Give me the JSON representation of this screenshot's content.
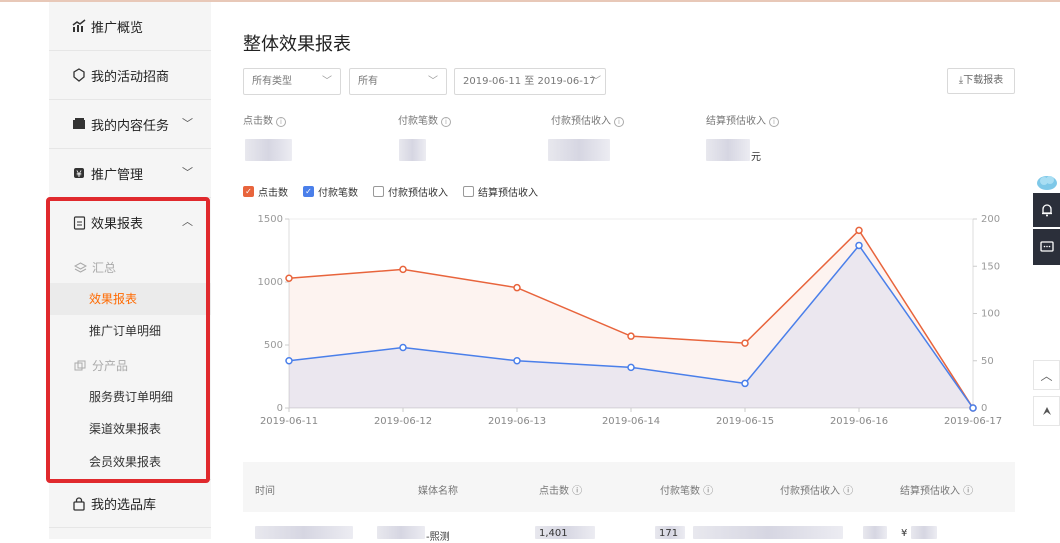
{
  "sidebar": {
    "items": [
      {
        "label": "推广概览",
        "icon": "chart-icon"
      },
      {
        "label": "我的活动招商",
        "icon": "shield-icon"
      },
      {
        "label": "我的内容任务",
        "icon": "book-icon"
      },
      {
        "label": "推广管理",
        "icon": "coin-icon"
      },
      {
        "label": "效果报表",
        "icon": "document-icon"
      },
      {
        "label": "我的选品库",
        "icon": "bag-icon"
      }
    ],
    "group_summary": "汇总",
    "group_product": "分产品",
    "sub_items": [
      "效果报表",
      "推广订单明细",
      "服务费订单明细",
      "渠道效果报表",
      "会员效果报表"
    ],
    "active_sub": "效果报表"
  },
  "main": {
    "title": "整体效果报表",
    "filters": {
      "type": "所有类型",
      "all": "所有",
      "date_range": "2019-06-11 至 2019-06-17"
    },
    "download_label": "下载报表",
    "metrics": [
      {
        "label": "点击数"
      },
      {
        "label": "付款笔数"
      },
      {
        "label": "付款预估收入"
      },
      {
        "label": "结算预估收入",
        "unit": "元"
      }
    ],
    "legend": [
      {
        "label": "点击数",
        "checked": true,
        "color": "#e8643c"
      },
      {
        "label": "付款笔数",
        "checked": true,
        "color": "#4a7fea"
      },
      {
        "label": "付款预估收入",
        "checked": false
      },
      {
        "label": "结算预估收入",
        "checked": false
      }
    ],
    "table": {
      "headers": [
        "时间",
        "媒体名称",
        "点击数",
        "付款笔数",
        "付款预估收入",
        "结算预估收入"
      ],
      "first_row": {
        "media": "-熙测",
        "clicks": "1,401",
        "payments": "171",
        "settle": "¥"
      }
    }
  },
  "chart_data": {
    "type": "line",
    "x": [
      "2019-06-11",
      "2019-06-12",
      "2019-06-13",
      "2019-06-14",
      "2019-06-15",
      "2019-06-16",
      "2019-06-17"
    ],
    "series": [
      {
        "name": "点击数",
        "axis": "left",
        "color": "#e8643c",
        "values": [
          1030,
          1100,
          955,
          570,
          515,
          1410,
          0
        ]
      },
      {
        "name": "付款笔数",
        "axis": "right",
        "color": "#4a7fea",
        "values": [
          50,
          64,
          50,
          43,
          26,
          172,
          0
        ]
      }
    ],
    "y_left": {
      "ticks": [
        "0",
        "500",
        "1000",
        "1500"
      ],
      "lim": [
        0,
        1500
      ]
    },
    "y_right": {
      "ticks": [
        "0",
        "50",
        "100",
        "150",
        "200"
      ],
      "lim": [
        0,
        200
      ]
    }
  },
  "floating": {
    "bell_icon": "bell-icon",
    "chat_icon": "chat-icon",
    "up_icon": "chevron-up-icon",
    "tool_icon": "tool-icon"
  }
}
